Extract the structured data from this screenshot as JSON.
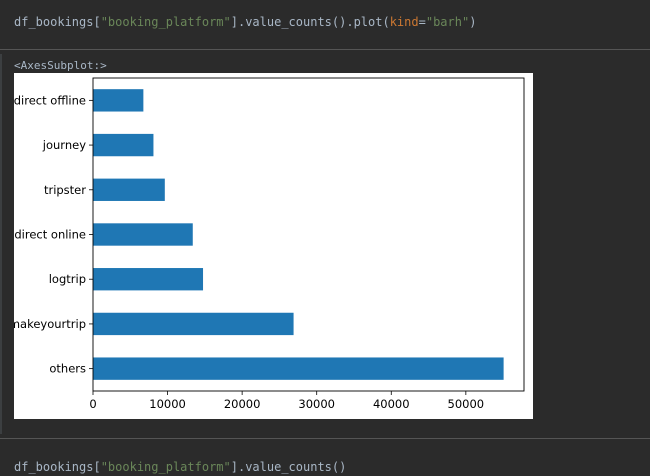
{
  "cells": {
    "input1": {
      "prefix": "df_bookings[",
      "string": "\"booking_platform\"",
      "middle": "].value_counts().plot(",
      "kwarg": "kind",
      "eq": "=",
      "kwval": "\"barh\"",
      "suffix": ")"
    },
    "output_text": "<AxesSubplot:>",
    "input2": {
      "prefix": "df_bookings[",
      "string": "\"booking_platform\"",
      "suffix": "].value_counts()"
    }
  },
  "colors": {
    "bar": "#1f77b4",
    "background": "#2b2b2b",
    "string": "#6a8759",
    "keyword": "#cc7832"
  },
  "chart_data": {
    "type": "bar",
    "orientation": "horizontal",
    "categories": [
      "others",
      "makeyourtrip",
      "logtrip",
      "direct online",
      "tripster",
      "journey",
      "direct offline"
    ],
    "values": [
      55066,
      26898,
      14756,
      13379,
      9630,
      8106,
      6755
    ],
    "xlim": [
      0,
      57800
    ],
    "xticks": [
      0,
      10000,
      20000,
      30000,
      40000,
      50000
    ],
    "xtick_labels": [
      "0",
      "10000",
      "20000",
      "30000",
      "40000",
      "50000"
    ],
    "title": "",
    "xlabel": "",
    "ylabel": "",
    "grid": false
  }
}
